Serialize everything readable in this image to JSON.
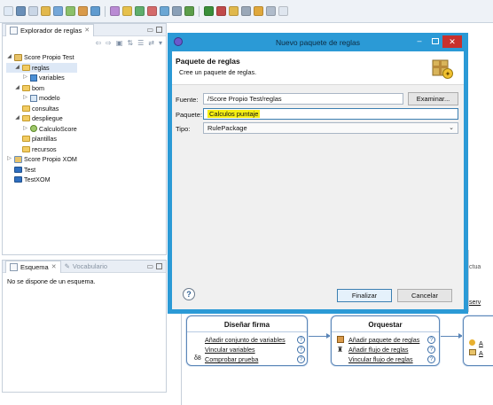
{
  "toolbar": {
    "icons": [
      {
        "name": "new-icon",
        "color": "#dfe9f5"
      },
      {
        "name": "save-icon",
        "color": "#6a8fb8"
      },
      {
        "name": "print-icon",
        "color": "#c9d6e6"
      },
      {
        "name": "package-icon",
        "color": "#e2b84c"
      },
      {
        "name": "rule-icon",
        "color": "#74a7d9"
      },
      {
        "name": "decision-table-icon",
        "color": "#8bc06a"
      },
      {
        "name": "tree-icon",
        "color": "#d99a4a"
      },
      {
        "name": "flow-icon",
        "color": "#5f9bd0"
      },
      {
        "name": "function-icon",
        "color": "#b98ad4"
      },
      {
        "name": "variable-icon",
        "color": "#e6c14c"
      },
      {
        "name": "bom-icon",
        "color": "#5fae6d"
      },
      {
        "name": "query-icon",
        "color": "#d46a6a"
      },
      {
        "name": "template-icon",
        "color": "#6aa6d4"
      },
      {
        "name": "deploy-icon",
        "color": "#8aa0b8"
      },
      {
        "name": "debug-icon",
        "color": "#5c9e4a"
      },
      {
        "name": "run-icon",
        "color": "#3a8f3a"
      },
      {
        "name": "external-tools-icon",
        "color": "#c04a4a"
      },
      {
        "name": "search-icon",
        "color": "#e0b84c"
      },
      {
        "name": "annotation-icon",
        "color": "#9aa8b8"
      },
      {
        "name": "back-icon",
        "color": "#e0a83c"
      },
      {
        "name": "forward-icon",
        "color": "#b0bccb"
      },
      {
        "name": "perspective-icon",
        "color": "#dfe6ef"
      }
    ]
  },
  "explorer": {
    "tab_label": "Explorador de reglas",
    "tree": [
      {
        "label": "Score Propio Test",
        "level": 0,
        "twisty": "◢",
        "icon": "ic-proj",
        "name": "tree-item-score-propio-test"
      },
      {
        "label": "reglas",
        "level": 1,
        "twisty": "◢",
        "icon": "ic-folder",
        "name": "tree-item-reglas",
        "selected": true
      },
      {
        "label": "variables",
        "level": 2,
        "twisty": "▷",
        "icon": "ic-var",
        "name": "tree-item-variables"
      },
      {
        "label": "bom",
        "level": 1,
        "twisty": "◢",
        "icon": "ic-folder",
        "name": "tree-item-bom"
      },
      {
        "label": "modelo",
        "level": 2,
        "twisty": "▷",
        "icon": "ic-model",
        "name": "tree-item-modelo"
      },
      {
        "label": "consultas",
        "level": 1,
        "twisty": "",
        "icon": "ic-folder",
        "name": "tree-item-consultas"
      },
      {
        "label": "despliegue",
        "level": 1,
        "twisty": "◢",
        "icon": "ic-folder",
        "name": "tree-item-despliegue"
      },
      {
        "label": "CalculoScore",
        "level": 2,
        "twisty": "▷",
        "icon": "ic-score",
        "name": "tree-item-calculoscore"
      },
      {
        "label": "plantillas",
        "level": 1,
        "twisty": "",
        "icon": "ic-folder",
        "name": "tree-item-plantillas"
      },
      {
        "label": "recursos",
        "level": 1,
        "twisty": "",
        "icon": "ic-folder",
        "name": "tree-item-recursos"
      },
      {
        "label": "Score Propio XOM",
        "level": 0,
        "twisty": "▷",
        "icon": "ic-xom",
        "name": "tree-item-score-propio-xom"
      },
      {
        "label": "Test",
        "level": 0,
        "twisty": "",
        "icon": "ic-blue-folder",
        "name": "tree-item-test"
      },
      {
        "label": "TestXOM",
        "level": 0,
        "twisty": "",
        "icon": "ic-blue-folder",
        "name": "tree-item-testxom"
      }
    ]
  },
  "outline": {
    "tab_label": "Esquema",
    "tab2_label": "Vocabulario",
    "message": "No se dispone de un esquema."
  },
  "dialog": {
    "title": "Nuevo paquete de reglas",
    "header_title": "Paquete de reglas",
    "header_subtitle": "Cree un paquete de reglas.",
    "fuente_label": "Fuente:",
    "fuente_value": "/Score Propio Test/reglas",
    "examinar_label": "Examinar...",
    "paquete_label": "Paquete:",
    "paquete_value": "Calculos puntaje",
    "tipo_label": "Tipo:",
    "tipo_value": "RulePackage",
    "finalizar_label": "Finalizar",
    "cancelar_label": "Cancelar",
    "help_symbol": "?",
    "close_symbol": "✕",
    "min_symbol": "–",
    "highlight_color": "#f6ef12"
  },
  "flow": {
    "design_card": {
      "title": "Diseñar firma",
      "links": [
        "Añadir conjunto de variables",
        "Vincular variables",
        "Comprobar prueba"
      ]
    },
    "orchestrate_card": {
      "title": "Orquestar",
      "links": [
        "Añadir paquete de reglas",
        "Añadir flujo de reglas",
        "Vincular flujo de reglas"
      ]
    },
    "partial_top_text": "ctua",
    "partial_link": "serv",
    "partial_card_a": "A",
    "partial_card_b": "A"
  }
}
